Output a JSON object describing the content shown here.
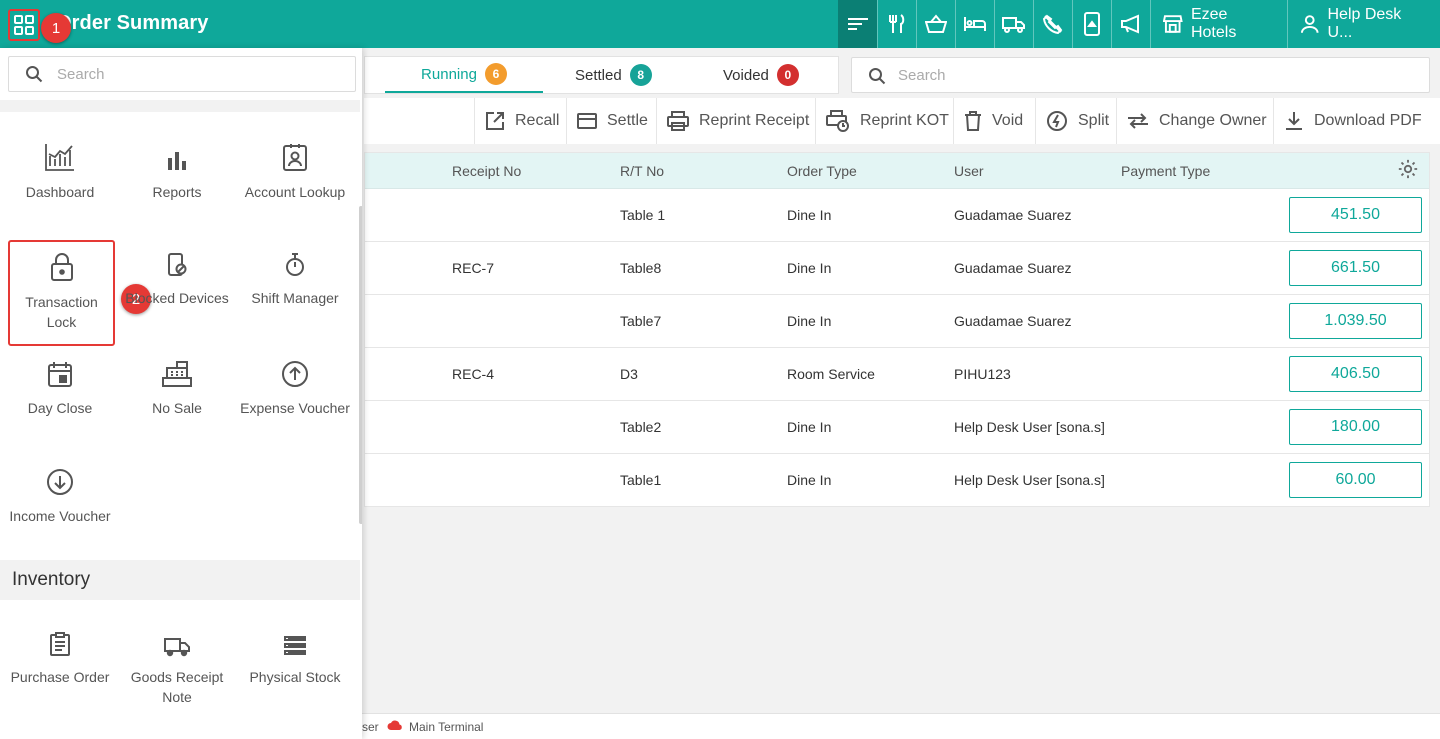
{
  "header": {
    "title": "Order Summary",
    "apps_icon": "grid-apps-icon",
    "property_name": "Ezee Hotels",
    "user_name": "Help Desk U...",
    "nav_icons": [
      "sort-icon",
      "restaurant-icon",
      "basket-icon",
      "bed-icon",
      "truck-icon",
      "no-phone-icon",
      "mobile-order-icon",
      "megaphone-icon"
    ]
  },
  "callouts": {
    "one": "1",
    "two": "2"
  },
  "tabs": [
    {
      "label": "Running",
      "count": "6",
      "color": "#f39c2d"
    },
    {
      "label": "Settled",
      "count": "8",
      "color": "#17a398"
    },
    {
      "label": "Voided",
      "count": "0",
      "color": "#d32f2f"
    }
  ],
  "search": {
    "placeholder": "Search"
  },
  "toolbar": {
    "recall": "Recall",
    "settle": "Settle",
    "reprint_receipt": "Reprint Receipt",
    "reprint_kot": "Reprint KOT",
    "void": "Void",
    "split": "Split",
    "change_owner": "Change Owner",
    "download_pdf": "Download PDF"
  },
  "table": {
    "columns": [
      "Receipt No",
      "R/T No",
      "Order Type",
      "User",
      "Payment Type"
    ],
    "rows": [
      {
        "receipt": "",
        "rt": "Table 1",
        "type": "Dine In",
        "user": "Guadamae Suarez",
        "amount": "451.50"
      },
      {
        "receipt": "REC-7",
        "rt": "Table8",
        "type": "Dine In",
        "user": "Guadamae Suarez",
        "amount": "661.50"
      },
      {
        "receipt": "",
        "rt": "Table7",
        "type": "Dine In",
        "user": "Guadamae Suarez",
        "amount": "1.039.50"
      },
      {
        "receipt": "REC-4",
        "rt": "D3",
        "type": "Room Service",
        "user": "PIHU123",
        "amount": "406.50"
      },
      {
        "receipt": "",
        "rt": "Table2",
        "type": "Dine In",
        "user": "Help Desk User [sona.s]",
        "amount": "180.00"
      },
      {
        "receipt": "",
        "rt": "Table1",
        "type": "Dine In",
        "user": "Help Desk User [sona.s]",
        "amount": "60.00"
      }
    ]
  },
  "footer": {
    "user_fragment": "ser",
    "terminal": "Main Terminal"
  },
  "side_menu": {
    "search_placeholder": "Search",
    "items": [
      {
        "label": "Dashboard",
        "icon": "dashboard-icon"
      },
      {
        "label": "Reports",
        "icon": "bar-chart-icon"
      },
      {
        "label": "Account Lookup",
        "icon": "account-lookup-icon"
      },
      {
        "label": "Transaction Lock",
        "icon": "lock-icon"
      },
      {
        "label": "Blocked Devices",
        "icon": "blocked-device-icon"
      },
      {
        "label": "Shift Manager",
        "icon": "stopwatch-icon"
      },
      {
        "label": "Day Close",
        "icon": "calendar-icon"
      },
      {
        "label": "No Sale",
        "icon": "cash-register-icon"
      },
      {
        "label": "Expense Voucher",
        "icon": "arrow-up-circle-icon"
      },
      {
        "label": "Income Voucher",
        "icon": "arrow-down-circle-icon"
      }
    ],
    "inventory_title": "Inventory",
    "inventory_items": [
      {
        "label": "Purchase Order",
        "icon": "clipboard-icon"
      },
      {
        "label": "Goods Receipt Note",
        "icon": "delivery-truck-icon"
      },
      {
        "label": "Physical Stock",
        "icon": "storage-icon"
      }
    ]
  }
}
